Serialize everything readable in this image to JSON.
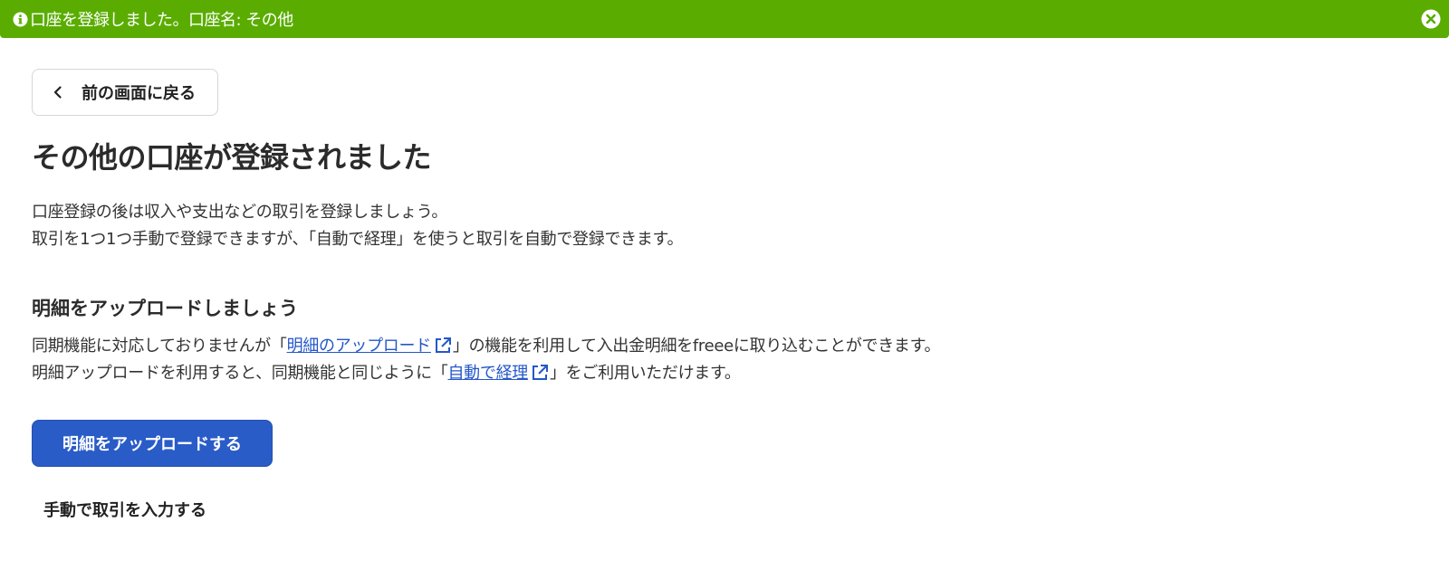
{
  "banner": {
    "message": "口座を登録しました。口座名: その他",
    "info_icon": "info-circle-icon",
    "close_icon": "close-circle-icon",
    "background": "#5aad00"
  },
  "back": {
    "label": "前の画面に戻る",
    "icon": "chevron-left-icon"
  },
  "title": "その他の口座が登録されました",
  "intro": {
    "line1": "口座登録の後は収入や支出などの取引を登録しましょう。",
    "line2": "取引を1つ1つ手動で登録できますが、「自動で経理」を使うと取引を自動で登録できます。"
  },
  "section": {
    "title": "明細をアップロードしましょう",
    "line1_pre": "同期機能に対応しておりませんが「",
    "line1_link": "明細のアップロード",
    "line1_post": "」の機能を利用して入出金明細をfreeeに取り込むことができます。",
    "line2_pre": "明細アップロードを利用すると、同期機能と同じように「",
    "line2_link": "自動で経理",
    "line2_post": "」をご利用いただけます。",
    "link_color": "#2457c9",
    "external_icon": "external-link-icon"
  },
  "actions": {
    "primary_label": "明細をアップロードする",
    "primary_color": "#2a5cc8",
    "secondary_label": "手動で取引を入力する"
  }
}
